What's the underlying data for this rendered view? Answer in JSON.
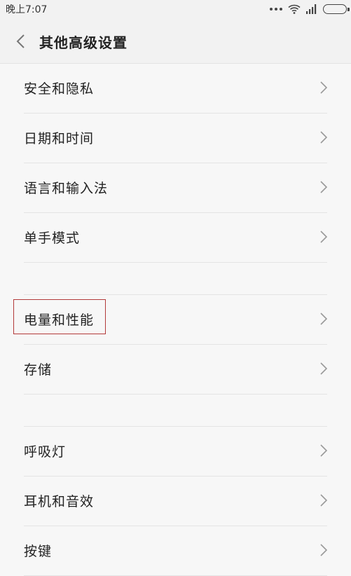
{
  "status_bar": {
    "time": "晚上7:07"
  },
  "header": {
    "title": "其他高级设置"
  },
  "settings": {
    "group1": [
      {
        "label": "安全和隐私"
      },
      {
        "label": "日期和时间"
      },
      {
        "label": "语言和输入法"
      },
      {
        "label": "单手模式"
      }
    ],
    "group2": [
      {
        "label": "电量和性能"
      },
      {
        "label": "存储"
      }
    ],
    "group3": [
      {
        "label": "呼吸灯"
      },
      {
        "label": "耳机和音效"
      },
      {
        "label": "按键"
      }
    ]
  },
  "icons": {
    "back": "chevron-left-icon",
    "row_arrow": "chevron-right-icon",
    "wifi": "wifi-icon",
    "signal": "signal-icon",
    "battery": "battery-icon"
  },
  "colors": {
    "highlight": "#b33a3a"
  }
}
